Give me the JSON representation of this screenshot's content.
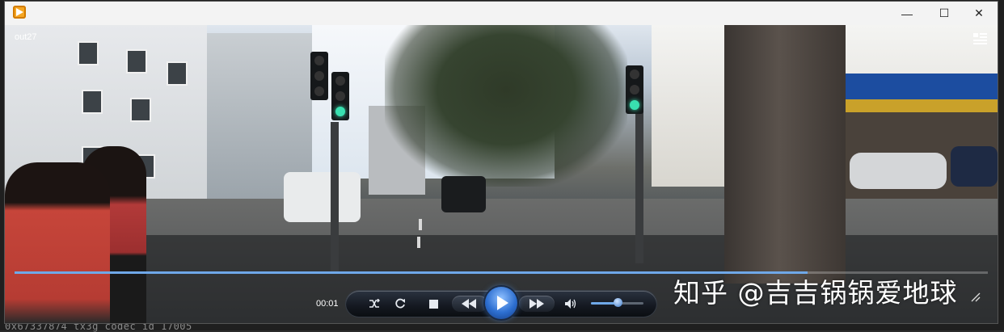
{
  "terminal": {
    "text": "0x67337874 tx3g codec id 17005"
  },
  "window": {
    "minimize_label": "—",
    "maximize_label": "☐",
    "close_label": "✕",
    "app_icon": "media-player-icon"
  },
  "player": {
    "video_title": "out27",
    "elapsed_time": "00:01",
    "progress": 0.815,
    "volume": 0.5,
    "icons": {
      "switch_view": "switch-to-library-icon",
      "shuffle": "shuffle-icon",
      "repeat": "repeat-icon",
      "stop": "stop-icon",
      "previous": "previous-icon",
      "play": "play-icon",
      "next": "next-icon",
      "volume": "volume-icon"
    },
    "accent_color": "#6fa8e8"
  },
  "watermark": {
    "text": "知乎 @吉吉锅锅爱地球"
  }
}
